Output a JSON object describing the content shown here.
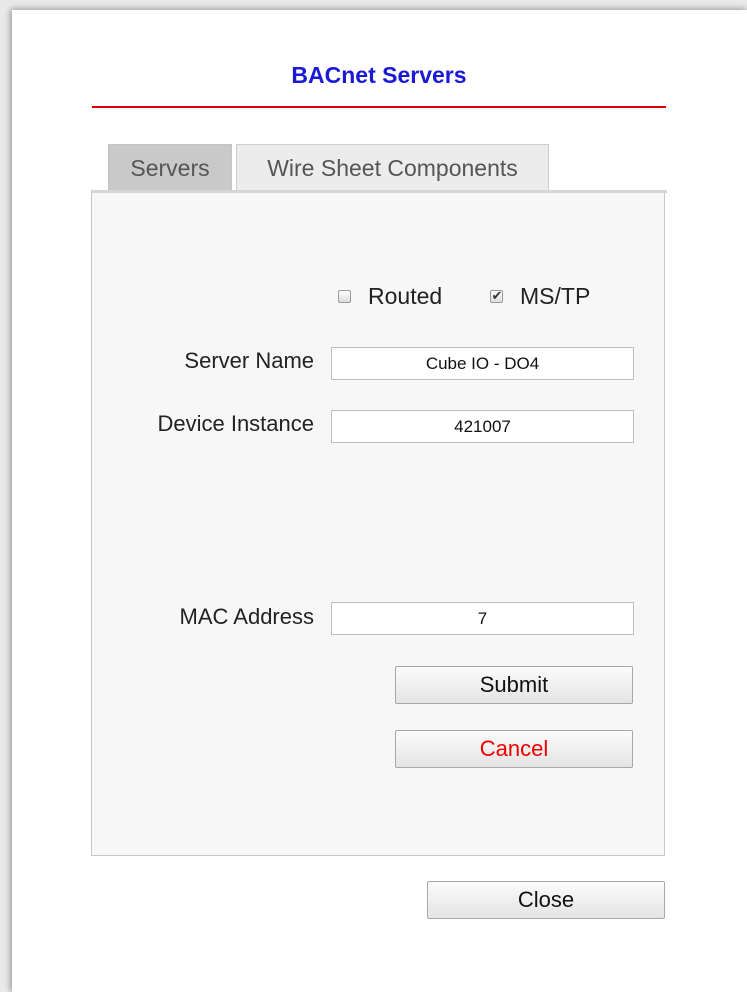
{
  "dialog": {
    "title": "BACnet Servers"
  },
  "tabs": [
    {
      "label": "Servers",
      "active": true
    },
    {
      "label": "Wire Sheet Components",
      "active": false
    }
  ],
  "options": {
    "routed": {
      "label": "Routed",
      "checked": false
    },
    "mstp": {
      "label": "MS/TP",
      "checked": true
    }
  },
  "form": {
    "server_name": {
      "label": "Server Name",
      "value": "Cube IO - DO4"
    },
    "device_instance": {
      "label": "Device Instance",
      "value": "421007"
    },
    "mac_address": {
      "label": "MAC Address",
      "value": "7"
    }
  },
  "buttons": {
    "submit": "Submit",
    "cancel": "Cancel",
    "close": "Close"
  },
  "colors": {
    "title": "#1a1ad6",
    "title_rule": "#e00000",
    "cancel_text": "#ee0000"
  },
  "icons": {
    "checkbox_checked": "check-mark-icon"
  }
}
